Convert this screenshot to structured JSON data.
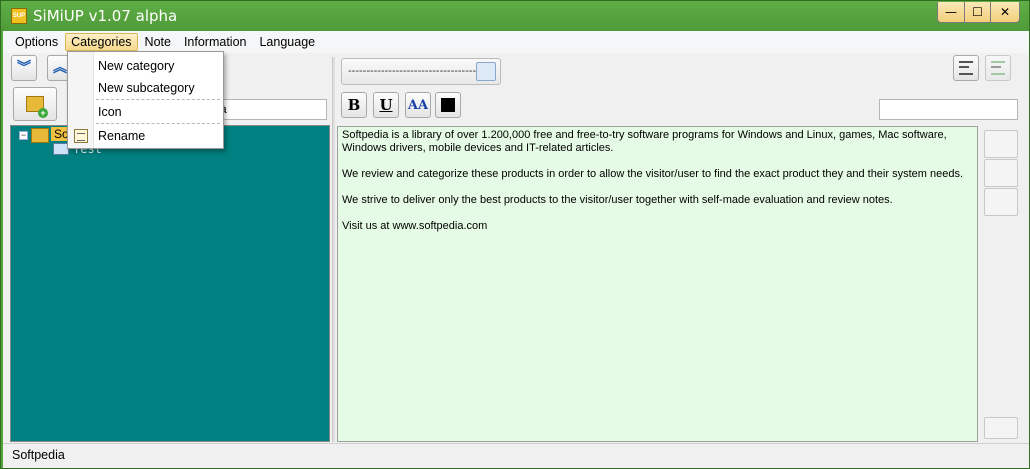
{
  "window": {
    "title": "SiMiUP v1.07 alpha",
    "app_icon_text": "SUP",
    "controls": {
      "minimize": "—",
      "maximize": "☐",
      "close": "✕"
    }
  },
  "menubar": {
    "items": [
      "Options",
      "Categories",
      "Note",
      "Information",
      "Language"
    ],
    "active": "Categories"
  },
  "categories_menu": {
    "items": [
      "New category",
      "New subcategory",
      "Icon",
      "Rename"
    ]
  },
  "left_toolbar": {
    "expand_all_icon": "double-chevron-down-icon",
    "collapse_all_icon": "double-chevron-up-icon",
    "add_note_icon": "folder-add-icon",
    "search_value": "edia"
  },
  "tree": {
    "root_label": "So",
    "child_label": "Test",
    "background": "#008080"
  },
  "editor_toolbar": {
    "title_placeholder": "------------------------------------",
    "bold_label": "B",
    "underline_label": "U",
    "font_label_main": "A",
    "font_label_sub": "A",
    "search_value": ""
  },
  "editor": {
    "paragraphs": [
      "Softpedia is a library of over 1.200,000 free and free-to-try software programs for Windows and Linux, games, Mac software, Windows drivers, mobile devices and IT-related articles.",
      "We review and categorize these products in order to allow the visitor/user to find the exact product they and their system needs.",
      "We strive to deliver only the best products to the visitor/user together with self-made evaluation and review notes.",
      "Visit us at www.softpedia.com"
    ],
    "background": "#e6fbe6"
  },
  "statusbar": {
    "text": "Softpedia"
  }
}
